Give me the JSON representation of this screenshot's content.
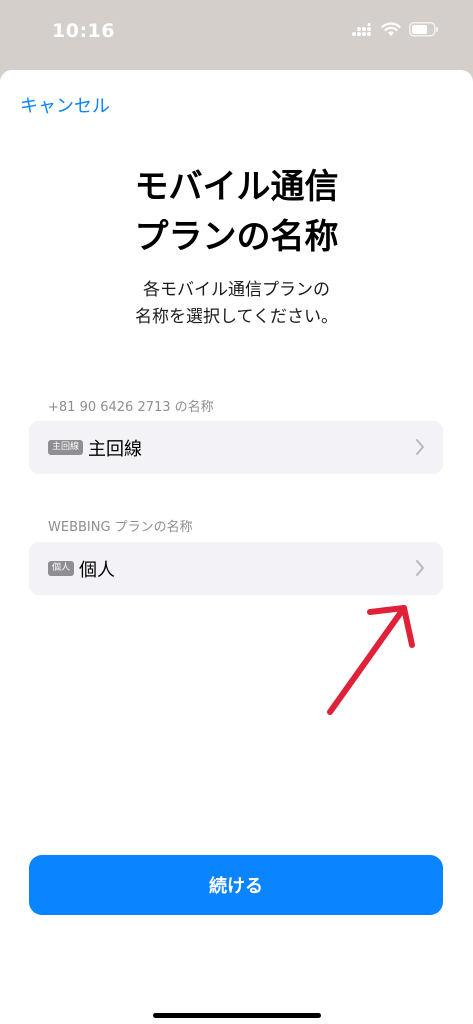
{
  "status_bar": {
    "time": "10:16",
    "icons": [
      "cellular-signal-icon",
      "wifi-icon",
      "battery-icon"
    ]
  },
  "nav": {
    "cancel_label": "キャンセル"
  },
  "header": {
    "title": "モバイル通信\nプランの名称",
    "subtitle": "各モバイル通信プランの\n名称を選択してください。"
  },
  "lines": [
    {
      "section_label": "+81 90 6426 2713 の名称",
      "badge": "主回線",
      "value": "主回線"
    },
    {
      "section_label": "WEBBING プランの名称",
      "badge": "個人",
      "value": "個人"
    }
  ],
  "footer": {
    "continue_label": "続ける"
  },
  "colors": {
    "accent": "#0a84ff",
    "annotation_arrow": "#e0213a",
    "row_background": "#f2f2f7",
    "badge_background": "#8e8e93"
  }
}
